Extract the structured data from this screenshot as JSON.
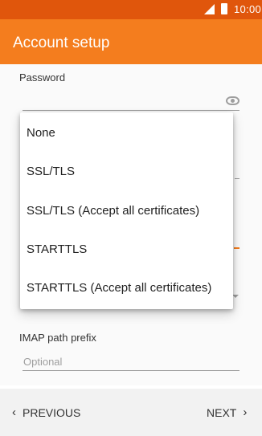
{
  "status_bar": {
    "time": "10:00"
  },
  "app_bar": {
    "title": "Account setup"
  },
  "form": {
    "password_label": "Password",
    "imap_prefix_label": "IMAP path prefix",
    "imap_prefix_placeholder": "Optional"
  },
  "dropdown": {
    "options": [
      "None",
      "SSL/TLS",
      "SSL/TLS (Accept all certificates)",
      "STARTTLS",
      "STARTTLS (Accept all certificates)"
    ]
  },
  "bottom_nav": {
    "previous_label": "PREVIOUS",
    "next_label": "NEXT"
  },
  "colors": {
    "status_bar": "#e0560c",
    "app_bar": "#f47d1e",
    "accent": "#f47d1e"
  }
}
